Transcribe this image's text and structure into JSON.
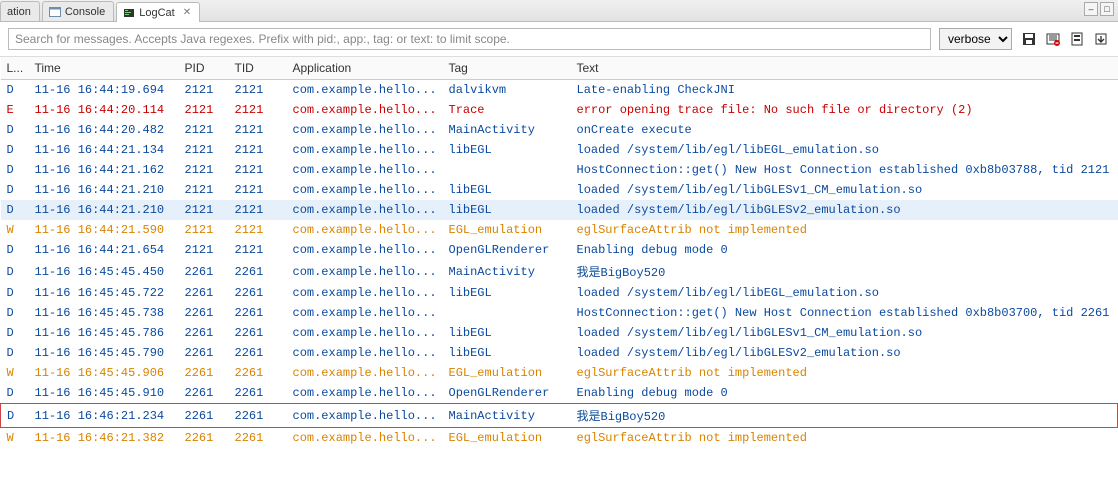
{
  "tabs": {
    "t0": "ation",
    "t1": "Console",
    "t2": "LogCat"
  },
  "search": {
    "placeholder": "Search for messages. Accepts Java regexes. Prefix with pid:, app:, tag: or text: to limit scope."
  },
  "level": {
    "selected": "verbose"
  },
  "columns": {
    "level": "L...",
    "time": "Time",
    "pid": "PID",
    "tid": "TID",
    "app": "Application",
    "tag": "Tag",
    "text": "Text"
  },
  "rows": [
    {
      "l": "D",
      "time": "11-16 16:44:19.694",
      "pid": "2121",
      "tid": "2121",
      "app": "com.example.hello...",
      "tag": "dalvikvm",
      "text": "Late-enabling CheckJNI"
    },
    {
      "l": "E",
      "time": "11-16 16:44:20.114",
      "pid": "2121",
      "tid": "2121",
      "app": "com.example.hello...",
      "tag": "Trace",
      "text": "error opening trace file: No such file or directory (2)"
    },
    {
      "l": "D",
      "time": "11-16 16:44:20.482",
      "pid": "2121",
      "tid": "2121",
      "app": "com.example.hello...",
      "tag": "MainActivity",
      "text": "onCreate execute"
    },
    {
      "l": "D",
      "time": "11-16 16:44:21.134",
      "pid": "2121",
      "tid": "2121",
      "app": "com.example.hello...",
      "tag": "libEGL",
      "text": "loaded /system/lib/egl/libEGL_emulation.so"
    },
    {
      "l": "D",
      "time": "11-16 16:44:21.162",
      "pid": "2121",
      "tid": "2121",
      "app": "com.example.hello...",
      "tag": "",
      "text": "HostConnection::get() New Host Connection established 0xb8b03788, tid 2121"
    },
    {
      "l": "D",
      "time": "11-16 16:44:21.210",
      "pid": "2121",
      "tid": "2121",
      "app": "com.example.hello...",
      "tag": "libEGL",
      "text": "loaded /system/lib/egl/libGLESv1_CM_emulation.so"
    },
    {
      "l": "D",
      "time": "11-16 16:44:21.210",
      "pid": "2121",
      "tid": "2121",
      "app": "com.example.hello...",
      "tag": "libEGL",
      "text": "loaded /system/lib/egl/libGLESv2_emulation.so",
      "sel": true
    },
    {
      "l": "W",
      "time": "11-16 16:44:21.590",
      "pid": "2121",
      "tid": "2121",
      "app": "com.example.hello...",
      "tag": "EGL_emulation",
      "text": "eglSurfaceAttrib not implemented"
    },
    {
      "l": "D",
      "time": "11-16 16:44:21.654",
      "pid": "2121",
      "tid": "2121",
      "app": "com.example.hello...",
      "tag": "OpenGLRenderer",
      "text": "Enabling debug mode 0"
    },
    {
      "l": "D",
      "time": "11-16 16:45:45.450",
      "pid": "2261",
      "tid": "2261",
      "app": "com.example.hello...",
      "tag": "MainActivity",
      "text": "我是BigBoy520"
    },
    {
      "l": "D",
      "time": "11-16 16:45:45.722",
      "pid": "2261",
      "tid": "2261",
      "app": "com.example.hello...",
      "tag": "libEGL",
      "text": "loaded /system/lib/egl/libEGL_emulation.so"
    },
    {
      "l": "D",
      "time": "11-16 16:45:45.738",
      "pid": "2261",
      "tid": "2261",
      "app": "com.example.hello...",
      "tag": "",
      "text": "HostConnection::get() New Host Connection established 0xb8b03700, tid 2261"
    },
    {
      "l": "D",
      "time": "11-16 16:45:45.786",
      "pid": "2261",
      "tid": "2261",
      "app": "com.example.hello...",
      "tag": "libEGL",
      "text": "loaded /system/lib/egl/libGLESv1_CM_emulation.so"
    },
    {
      "l": "D",
      "time": "11-16 16:45:45.790",
      "pid": "2261",
      "tid": "2261",
      "app": "com.example.hello...",
      "tag": "libEGL",
      "text": "loaded /system/lib/egl/libGLESv2_emulation.so"
    },
    {
      "l": "W",
      "time": "11-16 16:45:45.906",
      "pid": "2261",
      "tid": "2261",
      "app": "com.example.hello...",
      "tag": "EGL_emulation",
      "text": "eglSurfaceAttrib not implemented"
    },
    {
      "l": "D",
      "time": "11-16 16:45:45.910",
      "pid": "2261",
      "tid": "2261",
      "app": "com.example.hello...",
      "tag": "OpenGLRenderer",
      "text": "Enabling debug mode 0"
    },
    {
      "l": "D",
      "time": "11-16 16:46:21.234",
      "pid": "2261",
      "tid": "2261",
      "app": "com.example.hello...",
      "tag": "MainActivity",
      "text": "我是BigBoy520",
      "boxed": true
    },
    {
      "l": "W",
      "time": "11-16 16:46:21.382",
      "pid": "2261",
      "tid": "2261",
      "app": "com.example.hello...",
      "tag": "EGL_emulation",
      "text": "eglSurfaceAttrib not implemented"
    }
  ]
}
